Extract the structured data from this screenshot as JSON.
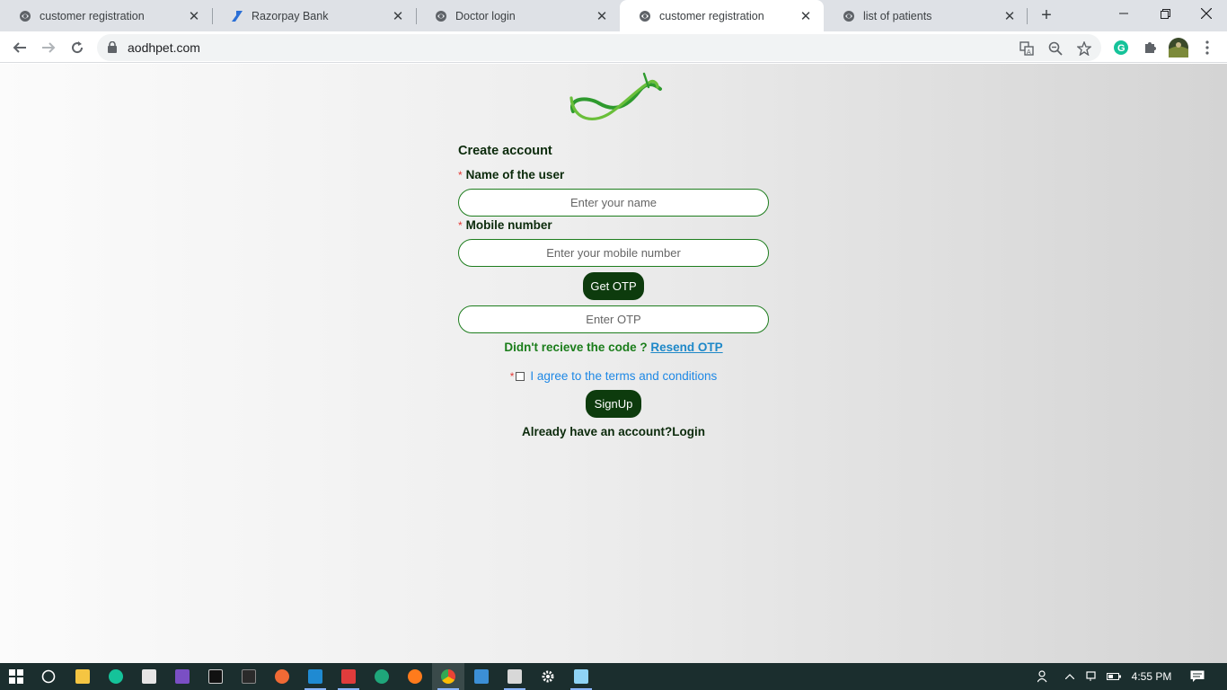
{
  "browser": {
    "tabs": [
      {
        "title": "customer registration",
        "icon": "globe-icon"
      },
      {
        "title": "Razorpay Bank",
        "icon": "razorpay-icon"
      },
      {
        "title": "Doctor login",
        "icon": "globe-icon"
      },
      {
        "title": "customer registration",
        "icon": "globe-icon",
        "active": true
      },
      {
        "title": "list of patients",
        "icon": "globe-icon"
      }
    ],
    "url": "aodhpet.com"
  },
  "form": {
    "heading": "Create account",
    "name_label": "Name of the user",
    "name_placeholder": "Enter your name",
    "mobile_label": "Mobile number",
    "mobile_placeholder": "Enter your mobile number",
    "get_otp_label": "Get OTP",
    "otp_placeholder": "Enter OTP",
    "resend_prompt": "Didn't recieve the code ?",
    "resend_link": "Resend OTP",
    "required_mark": "*",
    "agree_text": "I agree to the terms and conditions",
    "signup_label": "SignUp",
    "login_text": "Already have an account?Login"
  },
  "taskbar": {
    "time": "4:55 PM"
  },
  "colors": {
    "accent_green": "#0d3b0d",
    "border_green": "#1e7d1e",
    "link_blue": "#1e88e5",
    "required_red": "#e53935"
  }
}
